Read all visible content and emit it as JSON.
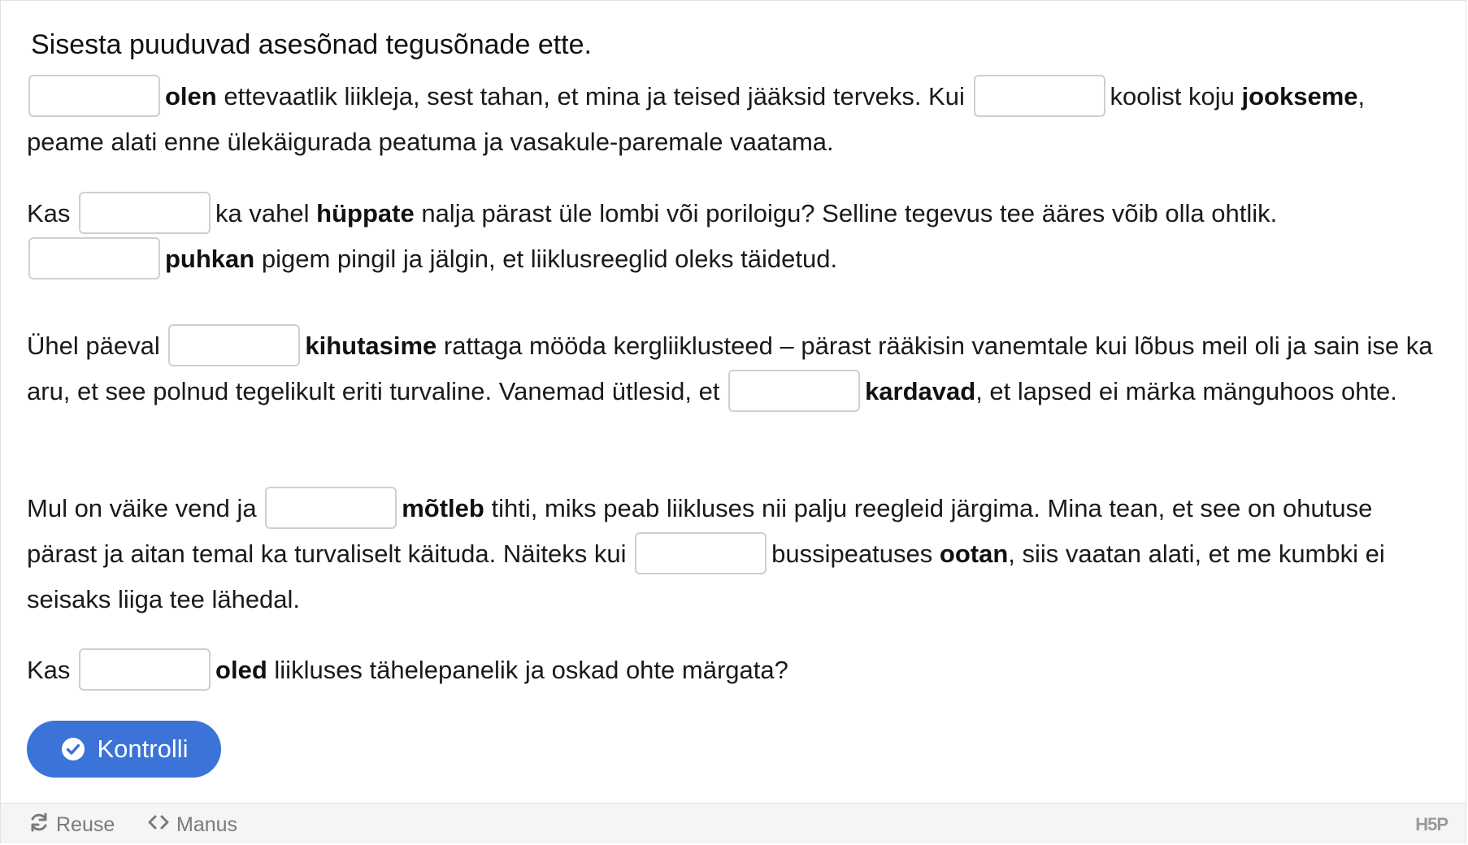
{
  "instructions": "Sisesta puuduvad asesõnad tegusõnade ette.",
  "paragraphs": {
    "p1": {
      "verb1": "olen",
      "text1": "ettevaatlik liikleja, sest tahan, et mina ja teised jääksid terveks. Kui",
      "text2": "koolist koju",
      "verb2": "jookseme",
      "text3": ",",
      "text4": "peame alati enne ülekäigurada peatuma ja vasakule-paremale vaatama."
    },
    "p2": {
      "text1": "Kas",
      "text2": "ka vahel",
      "verb1": "hüppate",
      "text3": "nalja pärast üle lombi või poriloigu? Selline tegevus tee ääres võib olla ohtlik.",
      "verb2": "puhkan",
      "text4": "pigem pingil ja jälgin, et liiklusreeglid oleks täidetud."
    },
    "p3": {
      "text1": "Ühel päeval",
      "verb1": "kihutasime",
      "text2": "rattaga mööda kergliiklusteed – pärast rääkisin vanemtale kui lõbus meil oli ja sain ise ka aru, et see polnud tegelikult eriti turvaline. Vanemad ütlesid, et",
      "verb2": "kardavad",
      "text3": ", et lapsed ei märka mänguhoos ohte."
    },
    "p4": {
      "text1": "Mul on väike vend ja",
      "verb1": "mõtleb",
      "text2": "tihti, miks peab liikluses nii palju reegleid järgima. Mina tean, et see on ohutuse pärast ja aitan temal ka turvaliselt käituda. Näiteks kui",
      "text3": "bussipeatuses",
      "verb2": "ootan",
      "text4": ", siis vaatan alati, et me kumbki ei seisaks liiga tee lähedal."
    },
    "p5": {
      "text1": "Kas",
      "verb1": "oled",
      "text2": "liikluses tähelepanelik ja oskad ohte märgata?"
    }
  },
  "check_button": {
    "label": "Kontrolli",
    "icon": "check-circle-icon"
  },
  "footer": {
    "reuse_label": "Reuse",
    "reuse_icon": "refresh-icon",
    "embed_label": "Manus",
    "embed_icon": "code-icon",
    "logo": "H5P"
  },
  "colors": {
    "accent": "#3b73d9",
    "footer_bg": "#f5f5f5",
    "footer_text": "#7a7a7a"
  }
}
